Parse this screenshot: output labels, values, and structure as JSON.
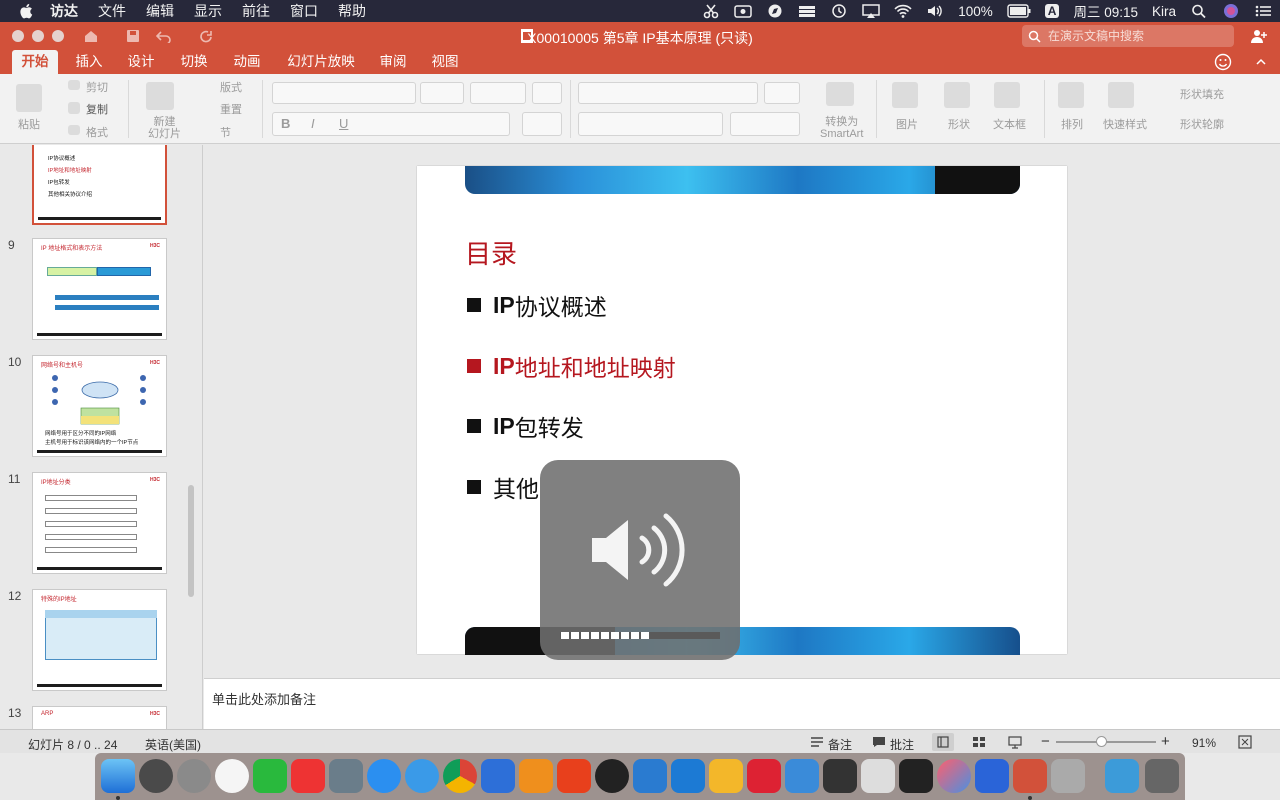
{
  "menubar": {
    "app": "访达",
    "items": [
      "文件",
      "编辑",
      "显示",
      "前往",
      "窗口",
      "帮助"
    ],
    "battery": "100%",
    "input_method": "A",
    "datetime": "周三 09:15",
    "user": "Kira"
  },
  "window": {
    "title": "X00010005 第5章 IP基本原理 (只读)",
    "search_placeholder": "在演示文稿中搜索"
  },
  "ribbon_tabs": [
    "开始",
    "插入",
    "设计",
    "切换",
    "动画",
    "幻灯片放映",
    "审阅",
    "视图"
  ],
  "ribbon": {
    "paste": "粘贴",
    "cut": "剪切",
    "copy": "复制",
    "format": "格式",
    "new_slide": "新建\n幻灯片",
    "layout": "版式",
    "reset": "重置",
    "section": "节",
    "convert_smartart": "转换为\nSmartArt",
    "picture": "图片",
    "shape": "形状",
    "textbox": "文本框",
    "arrange": "排列",
    "quick_styles": "快速样式",
    "shape_fill": "形状填充",
    "shape_outline": "形状轮廓"
  },
  "thumbnails": [
    {
      "number": "",
      "title": "",
      "lines": [
        "IP协议概述",
        "IP地址和地址映射",
        "IP包转发",
        "其他相关协议介绍"
      ],
      "selected": true
    },
    {
      "number": "9",
      "title": "IP 地址格式和表示方法",
      "selected": false
    },
    {
      "number": "10",
      "title": "网络号和主机号",
      "lines": [
        "网络号用于区分不同的IP网络",
        "主机号用于标识该网络内的一个IP节点"
      ],
      "selected": false
    },
    {
      "number": "11",
      "title": "IP地址分类",
      "selected": false
    },
    {
      "number": "12",
      "title": "特殊的IP地址",
      "selected": false
    },
    {
      "number": "13",
      "title": "ARP",
      "selected": false
    }
  ],
  "slide": {
    "title": "目录",
    "bullets": [
      {
        "prefix": "IP",
        "text": "协议概述",
        "highlight": false
      },
      {
        "prefix": "IP",
        "text": "地址和地址映射",
        "highlight": true
      },
      {
        "prefix": "IP",
        "text": "包转发",
        "highlight": false
      },
      {
        "prefix": "",
        "text": "其他",
        "highlight": false
      }
    ]
  },
  "notes": {
    "placeholder": "单击此处添加备注"
  },
  "status": {
    "slide_info": "幻灯片 8 / 0 .. 24",
    "language": "英语(美国)",
    "notes_btn": "备注",
    "comments_btn": "批注",
    "zoom": "91%"
  },
  "volume_hud": {
    "level": 0.56,
    "segments_total": 16,
    "segments_on": 9
  },
  "colors": {
    "accent": "#d2513a",
    "slide_red": "#b5171f"
  }
}
